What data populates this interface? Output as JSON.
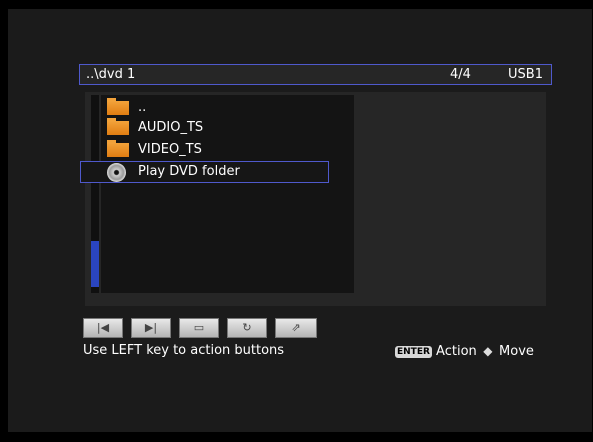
{
  "header": {
    "path": "..\\dvd 1",
    "count": "4/4",
    "device": "USB1"
  },
  "files": [
    {
      "label": "..",
      "icon": "folder-icon"
    },
    {
      "label": "AUDIO_TS",
      "icon": "folder-icon"
    },
    {
      "label": "VIDEO_TS",
      "icon": "folder-icon"
    },
    {
      "label": "Play DVD folder",
      "icon": "disc-icon",
      "selected": true
    }
  ],
  "buttons": [
    {
      "name": "previous",
      "glyph": "|◀"
    },
    {
      "name": "next",
      "glyph": "▶|"
    },
    {
      "name": "info",
      "glyph": "▭"
    },
    {
      "name": "repeat",
      "glyph": "↻"
    },
    {
      "name": "return",
      "glyph": "⇗"
    }
  ],
  "footer": {
    "hint": "Use LEFT key to action buttons",
    "enter_badge": "ENTER",
    "action_label": "Action",
    "move_glyph": "◆",
    "move_label": "Move"
  },
  "colors": {
    "accent": "#4f59cc",
    "folder": "#f2a23a",
    "scroll": "#2a45c0"
  }
}
